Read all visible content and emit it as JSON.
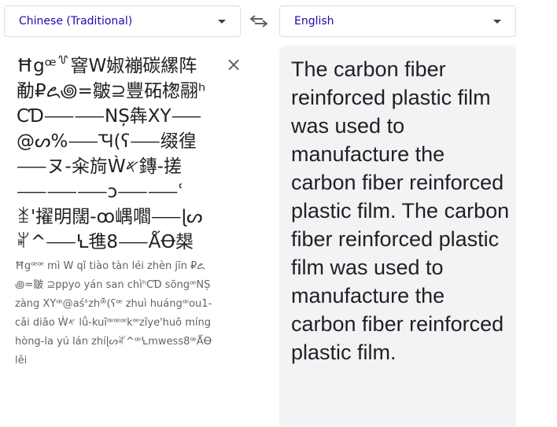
{
  "source_language": {
    "label": "Chinese (Traditional)"
  },
  "target_language": {
    "label": "English"
  },
  "swap_icon": "swap-horiz-icon",
  "clear_icon": "close-icon",
  "source": {
    "text": "Ħgꟹ꒷窨W婌䙖碳縲阵勈₽꧖꩜=皺⊇豐砳楤翮ʰCƊ⸺⸺NȘ犇XY⸺@ᔕ%⸺Ꚓ(ʕ⸺缀徨⸺ヌ-籴㫊Ẁ𐤀鏄-搓⸺⸺⸺ↄ⸺⸺ʿ ꁧ'擢明闊-ꝏ嵎嚪⸺ɭᔕꊍ^⸺Ꝇ㲝8⸺ǺꝊ槼",
    "romanization": "Ħgꟹꟹ mì W qǐ tiào tàn léi zhèn jīn ₽꧖꩜=皺 ⊇ppyo yán san chìʰCƊ sōngꟹNȘ zàng XYꟹ@aśᕑzhꟹ̃̇(ʕꟹ zhuì huángꟹou1-cǎi diāo Ẁ𐤀 lǚ-kuīꟹꟹꟹkꟹzǐye'huō míng hòng-la yú lán zhíɭᔕꊍ^ꟹꝆmwess8ꟹǺꝊ lěi"
  },
  "translation": {
    "text": "The carbon fiber reinforced plastic film was used to manufacture the carbon fiber reinforced plastic film. The carbon fiber reinforced plastic film was used to manufacture the carbon fiber reinforced plastic film."
  }
}
